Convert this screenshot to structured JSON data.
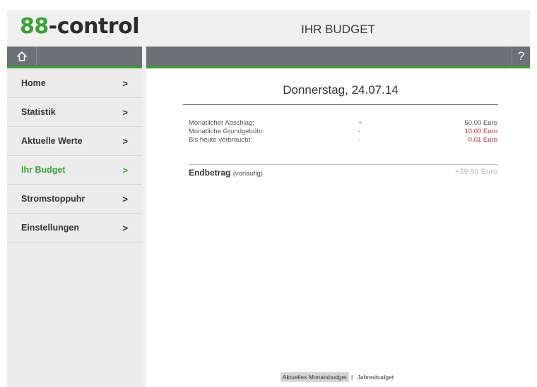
{
  "header": {
    "logo_num": "88",
    "logo_text": "-control",
    "title": "IHR BUDGET"
  },
  "toolbar": {
    "home_icon": "home-icon",
    "help_label": "?"
  },
  "sidebar": {
    "items": [
      {
        "label": "Home",
        "active": false
      },
      {
        "label": "Statistik",
        "active": false
      },
      {
        "label": "Aktuelle Werte",
        "active": false
      },
      {
        "label": "Ihr Budget",
        "active": true
      },
      {
        "label": "Stromstoppuhr",
        "active": false
      },
      {
        "label": "Einstellungen",
        "active": false
      }
    ],
    "chevron": ">"
  },
  "main": {
    "date": "Donnerstag, 24.07.14",
    "rows": [
      {
        "label": "Monatlicher Abschlag:",
        "sign": "+",
        "value": "50,00 Euro"
      },
      {
        "label": "Monatliche Grundgebühr:",
        "sign": "-",
        "value": "10,00 Euro"
      },
      {
        "label": "Bis heute verbraucht:",
        "sign": "-",
        "value": "0,01 Euro"
      }
    ],
    "total_label": "Endbetrag",
    "total_note": "(vorläufig)",
    "total_value": "+39,99 Euro"
  },
  "tabs": {
    "monthly": "Aktuelles Monatsbudget",
    "separator": "|",
    "yearly": "Jahresbudget"
  },
  "colors": {
    "accent_green": "#3aa23a",
    "bar_gray": "#6b7174",
    "negative_red": "#d03030"
  }
}
